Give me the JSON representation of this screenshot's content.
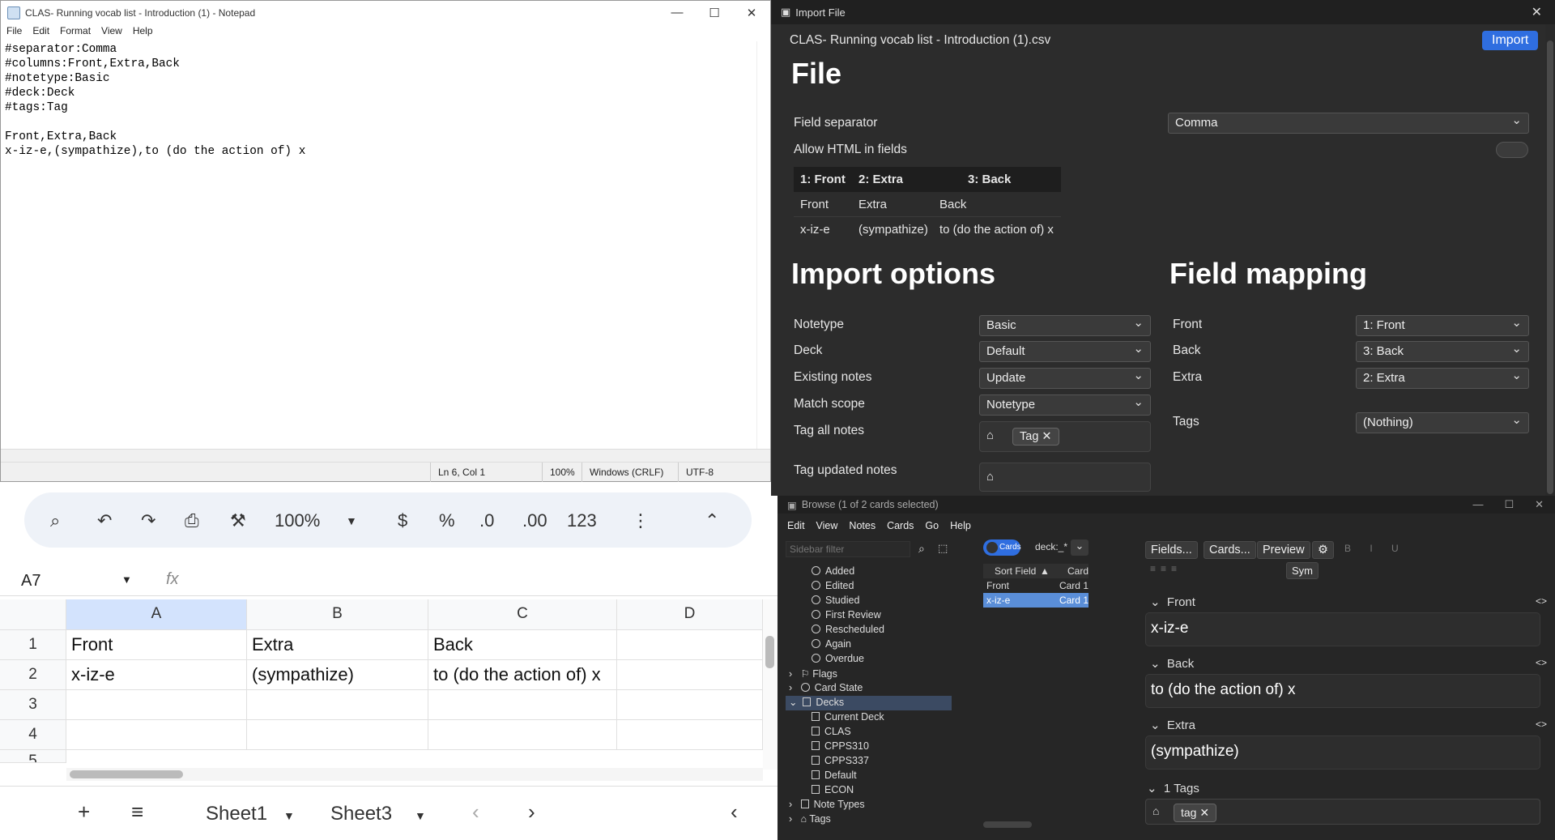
{
  "notepad": {
    "title": "CLAS- Running vocab list - Introduction (1) - Notepad",
    "menu": [
      "File",
      "Edit",
      "Format",
      "View",
      "Help"
    ],
    "lines": [
      "#separator:Comma",
      "#columns:Front,Extra,Back",
      "#notetype:Basic",
      "#deck:Deck",
      "#tags:Tag",
      "",
      "Front,Extra,Back",
      "x-iz-e,(sympathize),to (do the action of) x"
    ],
    "status": {
      "pos": "Ln 6, Col 1",
      "zoom": "100%",
      "eol": "Windows (CRLF)",
      "enc": "UTF-8"
    }
  },
  "sheets": {
    "zoom": "100%",
    "currency": "$",
    "percent": "%",
    "dec_less": ".0",
    "dec_more": ".00",
    "format": "123",
    "cell_ref": "A7",
    "fx": "fx",
    "cols": [
      "A",
      "B",
      "C",
      "D"
    ],
    "rows": [
      [
        "1",
        "Front",
        "Extra",
        "Back"
      ],
      [
        "2",
        "x-iz-e",
        "(sympathize)",
        "to (do the action of) x"
      ],
      [
        "3",
        "",
        "",
        ""
      ],
      [
        "4",
        "",
        "",
        ""
      ],
      [
        "5",
        "",
        "",
        ""
      ]
    ],
    "tabs": [
      "Sheet1",
      "Sheet3"
    ]
  },
  "import": {
    "title": "Import File",
    "file": "CLAS- Running vocab list - Introduction (1).csv",
    "import_btn": "Import",
    "h_file": "File",
    "field_sep_label": "Field separator",
    "field_sep": "Comma",
    "allow_html": "Allow HTML in fields",
    "preview": {
      "head": [
        "1: Front",
        "2: Extra",
        "3: Back"
      ],
      "rows": [
        [
          "Front",
          "Extra",
          "Back"
        ],
        [
          "x-iz-e",
          "(sympathize)",
          "to (do the action of) x"
        ]
      ]
    },
    "h_opts": "Import options",
    "h_map": "Field mapping",
    "opts": [
      {
        "label": "Notetype",
        "value": "Basic"
      },
      {
        "label": "Deck",
        "value": "Default"
      },
      {
        "label": "Existing notes",
        "value": "Update"
      },
      {
        "label": "Match scope",
        "value": "Notetype"
      }
    ],
    "tag_all": "Tag all notes",
    "tag_chip": "Tag",
    "tag_updated": "Tag updated notes",
    "map": [
      {
        "label": "Front",
        "value": "1: Front"
      },
      {
        "label": "Back",
        "value": "3: Back"
      },
      {
        "label": "Extra",
        "value": "2: Extra"
      },
      {
        "label": "Tags",
        "value": "(Nothing)"
      }
    ]
  },
  "browse": {
    "title": "Browse (1 of 2 cards selected)",
    "menu": [
      "Edit",
      "View",
      "Notes",
      "Cards",
      "Go",
      "Help"
    ],
    "filter_ph": "Sidebar filter",
    "toggle": "Cards",
    "search": "deck:_*",
    "sidebar": [
      "Added",
      "Edited",
      "Studied",
      "First Review",
      "Rescheduled",
      "Again",
      "Overdue",
      "Flags",
      "Card State",
      "Decks",
      "Current Deck",
      "CLAS",
      "CPPS310",
      "CPPS337",
      "Default",
      "ECON",
      "Note Types",
      "Tags"
    ],
    "table": {
      "h1": "Sort Field",
      "h2": "Card",
      "rows": [
        [
          "Front",
          "Card 1"
        ],
        [
          "x-iz-e",
          "Card 1"
        ]
      ]
    },
    "btns": [
      "Fields...",
      "Cards...",
      "Preview"
    ],
    "sym": "Sym",
    "fields": [
      {
        "label": "Front",
        "value": "x-iz-e"
      },
      {
        "label": "Back",
        "value": "to (do the action of) x"
      },
      {
        "label": "Extra",
        "value": "(sympathize)"
      }
    ],
    "tags_label": "1 Tags",
    "tag": "tag"
  }
}
